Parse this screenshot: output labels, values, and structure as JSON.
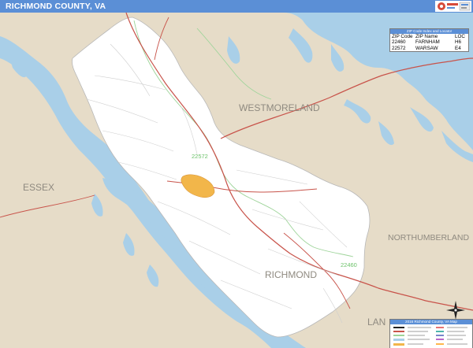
{
  "title": "RICHMOND COUNTY, VA",
  "colors": {
    "title_bar": "#5b8fd6",
    "water": "#a9cfe8",
    "land_outside": "#e6dcc8",
    "county_fill": "#ffffff",
    "highway": "#c8534a",
    "zip_boundary": "#9ed49a",
    "city_area": "#f2b64a"
  },
  "labels": {
    "westmoreland": "WESTMORELAND",
    "essex": "ESSEX",
    "northumberland": "NORTHUMBERLAND",
    "richmond": "RICHMOND",
    "lancaster_partial": "LAN",
    "zip_22572": "22572",
    "zip_22460": "22460"
  },
  "zip_table": {
    "heading": "ZIP Code Index and Locator",
    "columns": [
      "ZIP Code",
      "ZIP Name",
      "LOC"
    ],
    "rows": [
      [
        "22460",
        "FARNHAM",
        "H6"
      ],
      [
        "22572",
        "WARSAW",
        "E4"
      ]
    ]
  },
  "legend": {
    "heading": "2016 Richmond County, VA Map"
  }
}
